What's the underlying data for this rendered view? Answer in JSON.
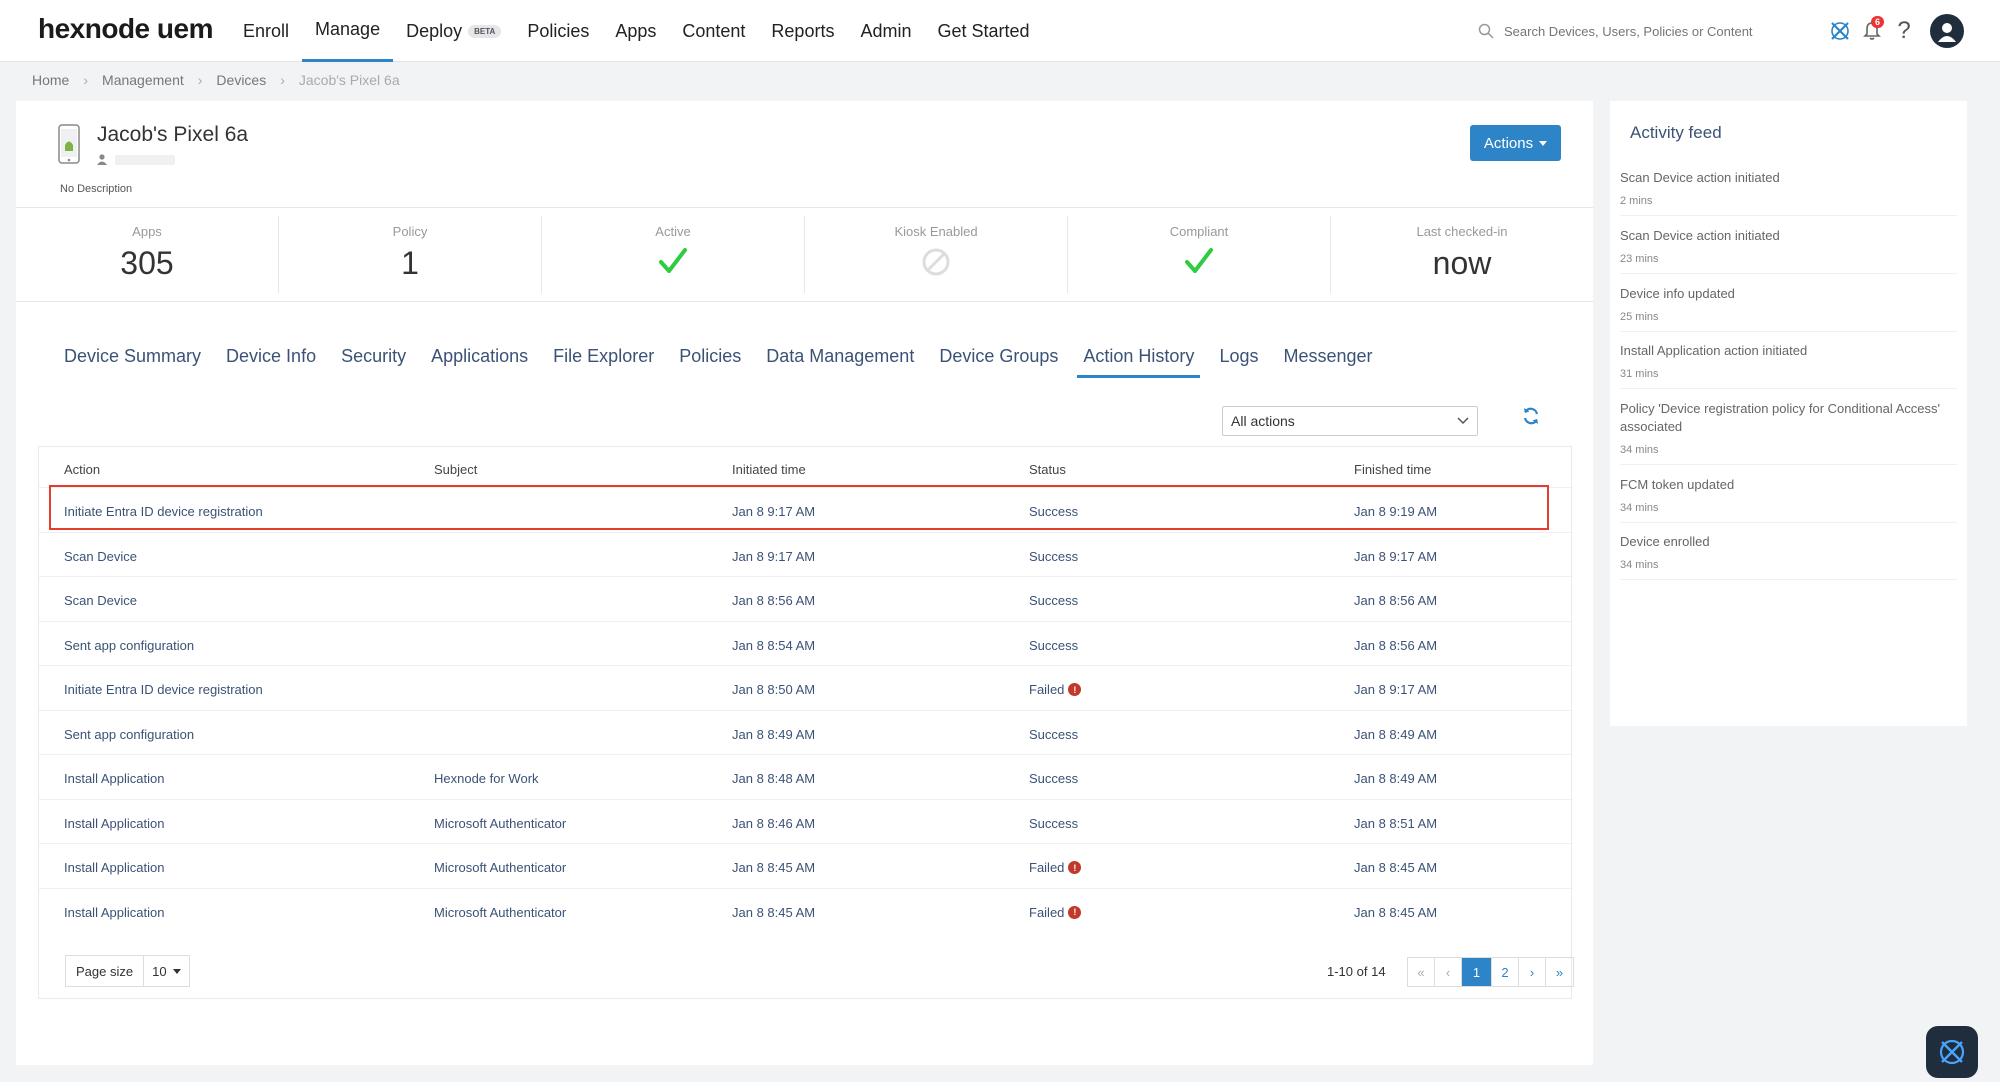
{
  "brand": {
    "logo": "hexnode uem"
  },
  "nav": {
    "items": [
      {
        "label": "Enroll"
      },
      {
        "label": "Manage"
      },
      {
        "label": "Deploy",
        "badge": "BETA"
      },
      {
        "label": "Policies"
      },
      {
        "label": "Apps"
      },
      {
        "label": "Content"
      },
      {
        "label": "Reports"
      },
      {
        "label": "Admin"
      },
      {
        "label": "Get Started"
      }
    ]
  },
  "search": {
    "placeholder": "Search Devices, Users, Policies or Content"
  },
  "notifications": {
    "count": "6"
  },
  "breadcrumb": [
    "Home",
    "Management",
    "Devices",
    "Jacob's Pixel 6a"
  ],
  "device": {
    "name": "Jacob's Pixel 6a",
    "description": "No Description",
    "actions_label": "Actions"
  },
  "stats": [
    {
      "label": "Apps",
      "value": "305",
      "kind": "number"
    },
    {
      "label": "Policy",
      "value": "1",
      "kind": "number"
    },
    {
      "label": "Active",
      "kind": "check"
    },
    {
      "label": "Kiosk Enabled",
      "kind": "disabled"
    },
    {
      "label": "Compliant",
      "kind": "check"
    },
    {
      "label": "Last checked-in",
      "value": "now",
      "kind": "number"
    }
  ],
  "tabs": [
    "Device Summary",
    "Device Info",
    "Security",
    "Applications",
    "File Explorer",
    "Policies",
    "Data Management",
    "Device Groups",
    "Action History",
    "Logs",
    "Messenger"
  ],
  "active_tab": "Action History",
  "filter": {
    "selected": "All actions"
  },
  "table": {
    "columns": [
      "Action",
      "Subject",
      "Initiated time",
      "Status",
      "Finished time"
    ],
    "rows": [
      {
        "action": "Initiate Entra ID device registration",
        "subject": "",
        "initiated": "Jan 8 9:17 AM",
        "status": "Success",
        "failed": false,
        "finished": "Jan 8 9:19 AM"
      },
      {
        "action": "Scan Device",
        "subject": "",
        "initiated": "Jan 8 9:17 AM",
        "status": "Success",
        "failed": false,
        "finished": "Jan 8 9:17 AM"
      },
      {
        "action": "Scan Device",
        "subject": "",
        "initiated": "Jan 8 8:56 AM",
        "status": "Success",
        "failed": false,
        "finished": "Jan 8 8:56 AM"
      },
      {
        "action": "Sent app configuration",
        "subject": "",
        "initiated": "Jan 8 8:54 AM",
        "status": "Success",
        "failed": false,
        "finished": "Jan 8 8:56 AM"
      },
      {
        "action": "Initiate Entra ID device registration",
        "subject": "",
        "initiated": "Jan 8 8:50 AM",
        "status": "Failed",
        "failed": true,
        "finished": "Jan 8 9:17 AM"
      },
      {
        "action": "Sent app configuration",
        "subject": "",
        "initiated": "Jan 8 8:49 AM",
        "status": "Success",
        "failed": false,
        "finished": "Jan 8 8:49 AM"
      },
      {
        "action": "Install Application",
        "subject": "Hexnode for Work",
        "initiated": "Jan 8 8:48 AM",
        "status": "Success",
        "failed": false,
        "finished": "Jan 8 8:49 AM"
      },
      {
        "action": "Install Application",
        "subject": "Microsoft Authenticator",
        "initiated": "Jan 8 8:46 AM",
        "status": "Success",
        "failed": false,
        "finished": "Jan 8 8:51 AM"
      },
      {
        "action": "Install Application",
        "subject": "Microsoft Authenticator",
        "initiated": "Jan 8 8:45 AM",
        "status": "Failed",
        "failed": true,
        "finished": "Jan 8 8:45 AM"
      },
      {
        "action": "Install Application",
        "subject": "Microsoft Authenticator",
        "initiated": "Jan 8 8:45 AM",
        "status": "Failed",
        "failed": true,
        "finished": "Jan 8 8:45 AM"
      }
    ]
  },
  "pagination": {
    "page_size_label": "Page size",
    "page_size": "10",
    "range": "1-10 of 14",
    "pages": [
      "«",
      "‹",
      "1",
      "2",
      "›",
      "»"
    ],
    "current_page": "1"
  },
  "activity_feed": {
    "title": "Activity feed",
    "items": [
      {
        "text": "Scan Device action initiated",
        "time": "2 mins"
      },
      {
        "text": "Scan Device action initiated",
        "time": "23 mins"
      },
      {
        "text": "Device info updated",
        "time": "25 mins"
      },
      {
        "text": "Install Application action initiated",
        "time": "31 mins"
      },
      {
        "text": "Policy 'Device registration policy for Conditional Access' associated",
        "time": "34 mins"
      },
      {
        "text": "FCM token updated",
        "time": "34 mins"
      },
      {
        "text": "Device enrolled",
        "time": "34 mins"
      }
    ]
  },
  "colors": {
    "accent": "#2d84c6",
    "check": "#2ecc40",
    "failed": "#c0392b",
    "highlight": "#e53d2d"
  }
}
